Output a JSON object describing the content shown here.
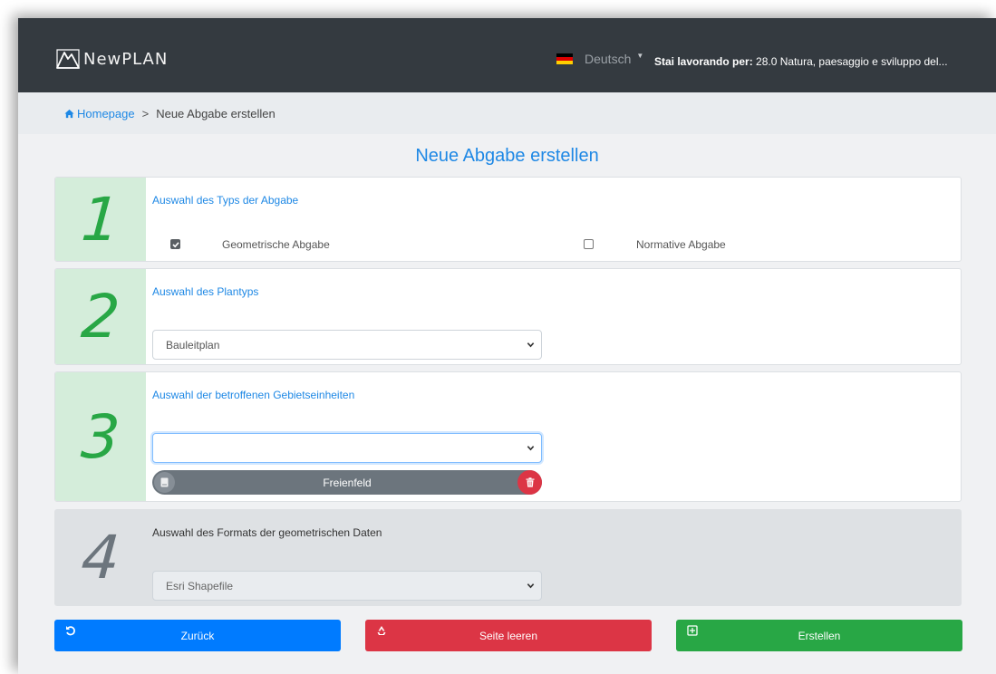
{
  "navbar": {
    "brand": "NewPLAN",
    "language": "Deutsch",
    "flag_colors": [
      "#000000",
      "#dd0000",
      "#ffce00"
    ],
    "work_label": "Stai lavorando per:",
    "work_value": "28.0 Natura, paesaggio e sviluppo del..."
  },
  "breadcrumb": {
    "home": "Homepage",
    "separator": ">",
    "current": "Neue Abgabe erstellen"
  },
  "page_title": "Neue Abgabe erstellen",
  "steps": [
    {
      "number": "1",
      "label": "Auswahl des Typs der Abgabe",
      "options": [
        {
          "label": "Geometrische Abgabe",
          "checked": true
        },
        {
          "label": "Normative Abgabe",
          "checked": false
        }
      ]
    },
    {
      "number": "2",
      "label": "Auswahl des Plantyps",
      "select_value": "Bauleitplan"
    },
    {
      "number": "3",
      "label": "Auswahl der betroffenen Gebietseinheiten",
      "select_value": "",
      "tag": "Freienfeld"
    },
    {
      "number": "4",
      "label": "Auswahl des Formats der geometrischen Daten",
      "select_value": "Esri Shapefile",
      "disabled": true
    }
  ],
  "buttons": {
    "back": "Zurück",
    "clear": "Seite leeren",
    "create": "Erstellen"
  },
  "colors": {
    "primary": "#007bff",
    "danger": "#dc3545",
    "success": "#28a745",
    "navbar": "#343a40"
  }
}
